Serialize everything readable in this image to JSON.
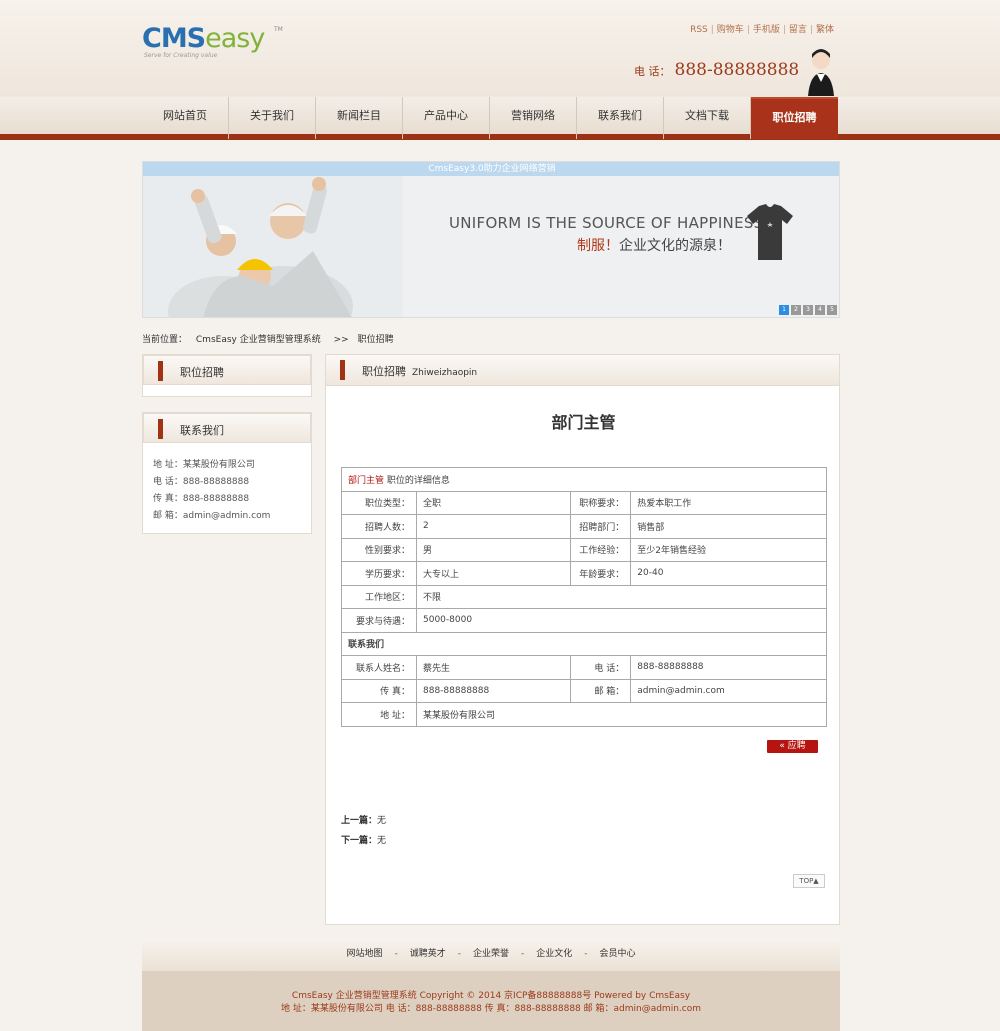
{
  "header": {
    "logo_main": "CMS",
    "logo_sub": "easy",
    "logo_tm": "TM",
    "logo_slogan": "Serve for Creating value",
    "top_links": [
      "RSS",
      "购物车",
      "手机版",
      "留言",
      "繁体"
    ],
    "phone_label": "电 话：",
    "phone_number": "888-88888888"
  },
  "nav": {
    "items": [
      "网站首页",
      "关于我们",
      "新闻栏目",
      "产品中心",
      "营销网络",
      "联系我们",
      "文档下载",
      "职位招聘"
    ],
    "active_index": 7
  },
  "banner": {
    "strip_text": "CmsEasy3.0助力企业网络营销",
    "headline_en": "UNIFORM IS THE SOURCE OF HAPPINESS",
    "headline_cn_red": "制服！",
    "headline_cn_rest": "企业文化的源泉！",
    "dots": [
      "1",
      "2",
      "3",
      "4",
      "5"
    ],
    "active_dot": 0
  },
  "breadcrumb": {
    "label": "当前位置：",
    "site": "CmsEasy 企业营销型管理系统",
    "sep": ">>",
    "current": "职位招聘"
  },
  "sidebar": {
    "box1_title": "职位招聘",
    "box2_title": "联系我们",
    "contact": [
      "地 址：某某股份有限公司",
      "电 话：888-88888888",
      "传 真：888-88888888",
      "邮 箱：admin@admin.com"
    ]
  },
  "main": {
    "section_title": "职位招聘",
    "section_pinyin": "Zhiweizhaopin",
    "job_title": "部门主管",
    "detail_head_red": "部门主管",
    "detail_head_rest": " 职位的详细信息",
    "rows": [
      {
        "l1": "职位类型：",
        "v1": "全职",
        "l2": "职称要求：",
        "v2": "热爱本职工作"
      },
      {
        "l1": "招聘人数：",
        "v1": "2",
        "l2": "招聘部门：",
        "v2": "销售部"
      },
      {
        "l1": "性别要求：",
        "v1": "男",
        "l2": "工作经验：",
        "v2": "至少2年销售经验"
      },
      {
        "l1": "学历要求：",
        "v1": "大专以上",
        "l2": "年龄要求：",
        "v2": "20-40"
      }
    ],
    "work_area_label": "工作地区：",
    "work_area": "不限",
    "pay_label": "要求与待遇：",
    "pay": "5000-8000",
    "contact_head": "联系我们",
    "contact_rows": [
      {
        "l1": "联系人姓名：",
        "v1": "蔡先生",
        "l2": "电 话：",
        "v2": "888-88888888"
      },
      {
        "l1": "传 真：",
        "v1": "888-88888888",
        "l2": "邮 箱：",
        "v2": "admin@admin.com"
      }
    ],
    "address_label": "地 址：",
    "address": "某某股份有限公司",
    "apply_label": "«    应聘",
    "prev_label": "上一篇：",
    "prev_value": "无",
    "next_label": "下一篇：",
    "next_value": "无",
    "top_label": "TOP▲"
  },
  "footer": {
    "links": [
      "网站地图",
      "诚聘英才",
      "企业荣誉",
      "企业文化",
      "会员中心"
    ],
    "line1": "CmsEasy 企业营销型管理系统  Copyright © 2014  京ICP备88888888号  Powered by CmsEasy",
    "line2": "地 址：某某股份有限公司  电 话：888-88888888  传 真：888-88888888  邮 箱：admin@admin.com"
  }
}
